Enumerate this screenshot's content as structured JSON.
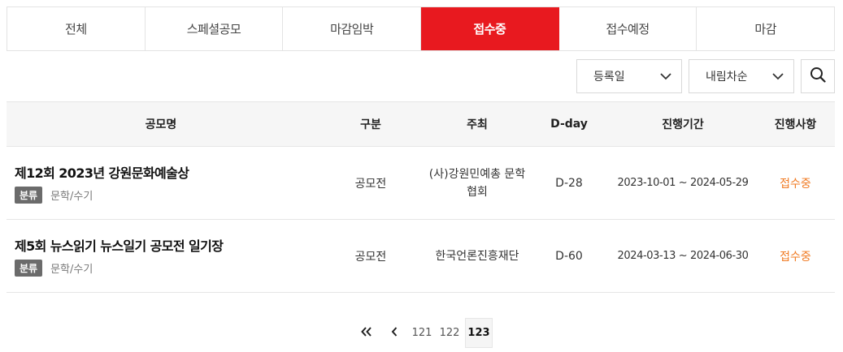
{
  "tabs": [
    "전체",
    "스페셜공모",
    "마감임박",
    "접수중",
    "접수예정",
    "마감"
  ],
  "active_tab": "접수중",
  "filters": {
    "sort_field": "등록일",
    "sort_order": "내림차순"
  },
  "table": {
    "headers": {
      "name": "공모명",
      "type": "구분",
      "host": "주최",
      "dday": "D-day",
      "period": "진행기간",
      "status": "진행사항"
    },
    "rows": [
      {
        "title": "제12회 2023년 강원문화예술상",
        "badge": "분류",
        "category": "문학/수기",
        "type": "공모전",
        "host": "(사)강원민예총 문학협회",
        "dday": "D-28",
        "period": "2023-10-01 ~ 2024-05-29",
        "status": "접수중"
      },
      {
        "title": "제5회 뉴스읽기 뉴스일기 공모전 일기장",
        "badge": "분류",
        "category": "문학/수기",
        "type": "공모전",
        "host": "한국언론진흥재단",
        "dday": "D-60",
        "period": "2024-03-13 ~ 2024-06-30",
        "status": "접수중"
      }
    ]
  },
  "pagination": {
    "first_icon": "double-chevron-left-icon",
    "prev_icon": "chevron-left-icon",
    "pages": [
      "121",
      "122",
      "123"
    ],
    "current": "123"
  },
  "colors": {
    "accent": "#e8191f",
    "status": "#f07a22",
    "badge": "#6b6b6b"
  }
}
